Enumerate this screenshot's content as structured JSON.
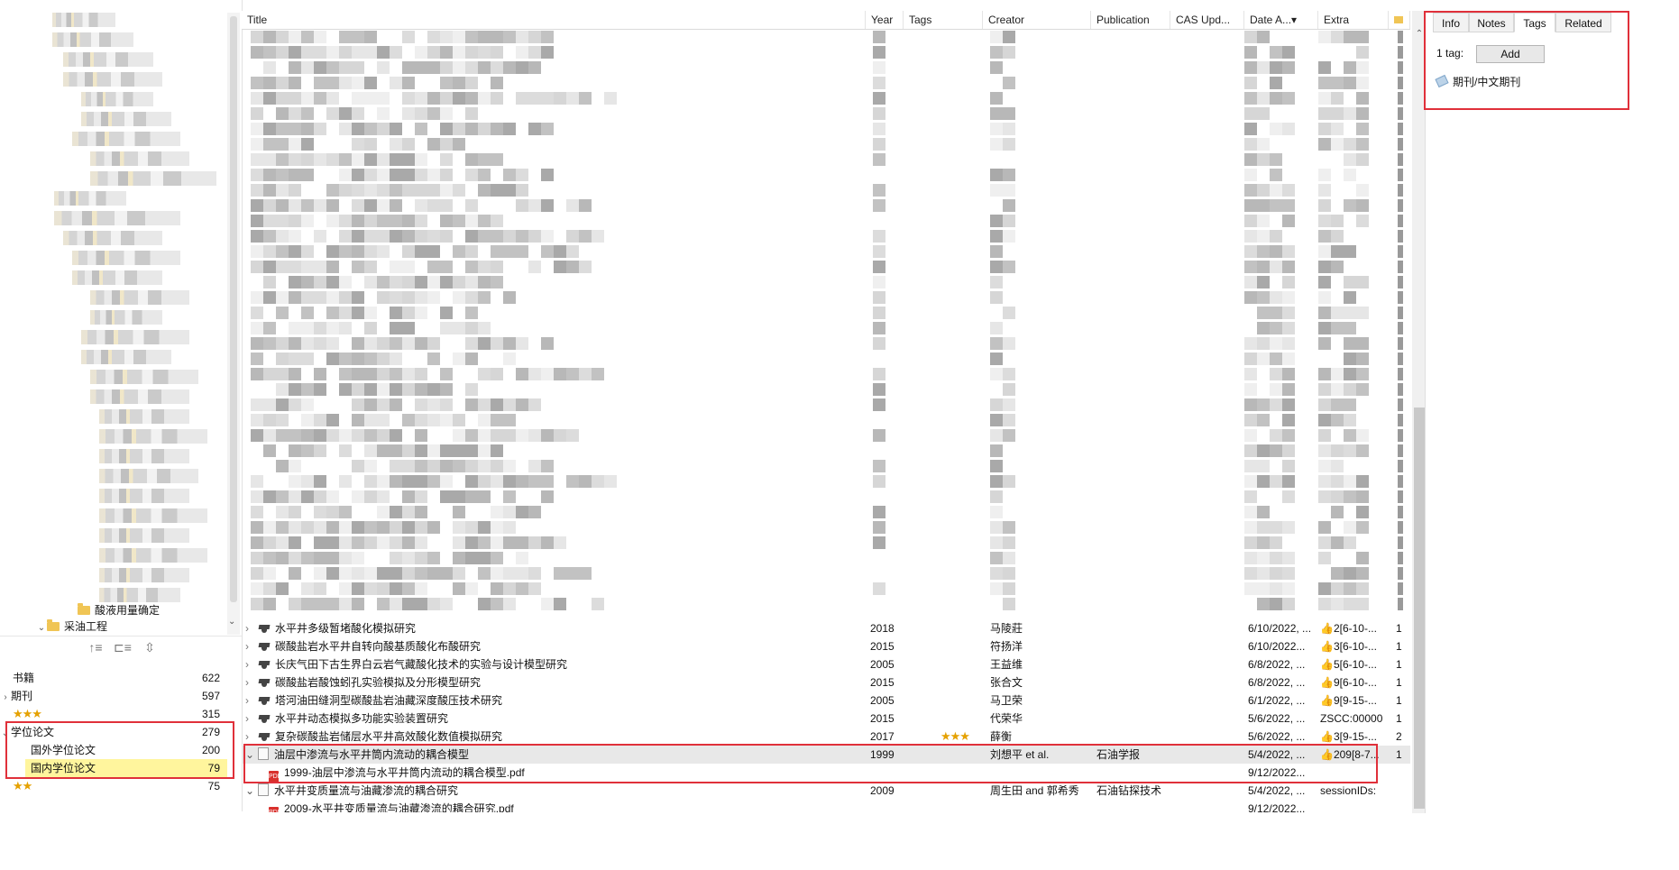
{
  "columns": {
    "title": "Title",
    "year": "Year",
    "tags": "Tags",
    "creator": "Creator",
    "publication": "Publication",
    "cas": "CAS Upd...",
    "date_added": "Date A...",
    "sort_arrow": "▾",
    "extra": "Extra"
  },
  "tree_items": {
    "acid": "酸液用量确定",
    "oil": "采油工程"
  },
  "tags_list": [
    {
      "label": "书籍",
      "count": "622",
      "expand": ""
    },
    {
      "label": "期刊",
      "count": "597",
      "expand": "›"
    },
    {
      "label": "★★★",
      "count": "315",
      "expand": ""
    },
    {
      "label": "学位论文",
      "count": "279",
      "expand": "⌄"
    },
    {
      "label": "国外学位论文",
      "count": "200",
      "expand": ""
    },
    {
      "label": "国内学位论文",
      "count": "79",
      "expand": ""
    },
    {
      "label": "★★",
      "count": "75",
      "expand": ""
    }
  ],
  "items": [
    {
      "title": "水平井多级暂堵酸化模拟研究",
      "year": "2018",
      "tags": "",
      "creator": "马陵莊",
      "publication": "",
      "date": "6/10/2022, ...",
      "extra": "👍2[6-10-...",
      "n": "1"
    },
    {
      "title": "碳酸盐岩水平井自转向酸基质酸化布酸研究",
      "year": "2015",
      "tags": "",
      "creator": "符扬洋",
      "publication": "",
      "date": "6/10/2022...",
      "extra": "👍3[6-10-...",
      "n": "1"
    },
    {
      "title": "长庆气田下古生界白云岩气藏酸化技术的实验与设计模型研究",
      "year": "2005",
      "tags": "",
      "creator": "王益维",
      "publication": "",
      "date": "6/8/2022, ...",
      "extra": "👍5[6-10-...",
      "n": "1"
    },
    {
      "title": "碳酸盐岩酸蚀蚓孔实验模拟及分形模型研究",
      "year": "2015",
      "tags": "",
      "creator": "张合文",
      "publication": "",
      "date": "6/8/2022, ...",
      "extra": "👍9[6-10-...",
      "n": "1"
    },
    {
      "title": "塔河油田缝洞型碳酸盐岩油藏深度酸压技术研究",
      "year": "2005",
      "tags": "",
      "creator": "马卫荣",
      "publication": "",
      "date": "6/1/2022, ...",
      "extra": "👍9[9-15-...",
      "n": "1"
    },
    {
      "title": "水平井动态模拟多功能实验装置研究",
      "year": "2015",
      "tags": "",
      "creator": "代荣华",
      "publication": "",
      "date": "5/6/2022, ...",
      "extra": "ZSCC:00000",
      "n": "1"
    },
    {
      "title": "复杂碳酸盐岩储层水平井高效酸化数值模拟研究",
      "year": "2017",
      "tags": "★★★",
      "creator": "薛衡",
      "publication": "",
      "date": "5/6/2022, ...",
      "extra": "👍3[9-15-...",
      "n": "2"
    }
  ],
  "selected_item": {
    "title": "油层中渗流与水平井筒内流动的耦合模型",
    "year": "1999",
    "creator": "刘想平 et al.",
    "publication": "石油学报",
    "date": "5/4/2022, ...",
    "extra": "👍209[8-7...",
    "n": "1"
  },
  "attachment1": {
    "title": "1999-油层中渗流与水平井筒内流动的耦合模型.pdf",
    "date": "9/12/2022..."
  },
  "item_next": {
    "title": "水平井变质量流与油藏渗流的耦合研究",
    "year": "2009",
    "creator": "周生田 and 郭希秀",
    "publication": "石油钻探技术",
    "date": "5/4/2022, ...",
    "extra": "sessionIDs:"
  },
  "attachment2": {
    "title": "2009-水平井变质量流与油藏渗流的耦合研究.pdf",
    "date": "9/12/2022..."
  },
  "right_tabs": {
    "info": "Info",
    "notes": "Notes",
    "tags": "Tags",
    "related": "Related"
  },
  "tags_pane": {
    "count_label": "1 tag:",
    "add_label": "Add",
    "tag": "期刊/中文期刊"
  },
  "colors": {
    "highlight": "#fff59d",
    "annotation_red": "#e0303a",
    "star": "#e5a100"
  },
  "icons": [
    "folder-icon",
    "graduation-cap-icon",
    "document-icon",
    "pdf-icon",
    "tag-icon",
    "thumbs-up-icon",
    "star-icon"
  ]
}
